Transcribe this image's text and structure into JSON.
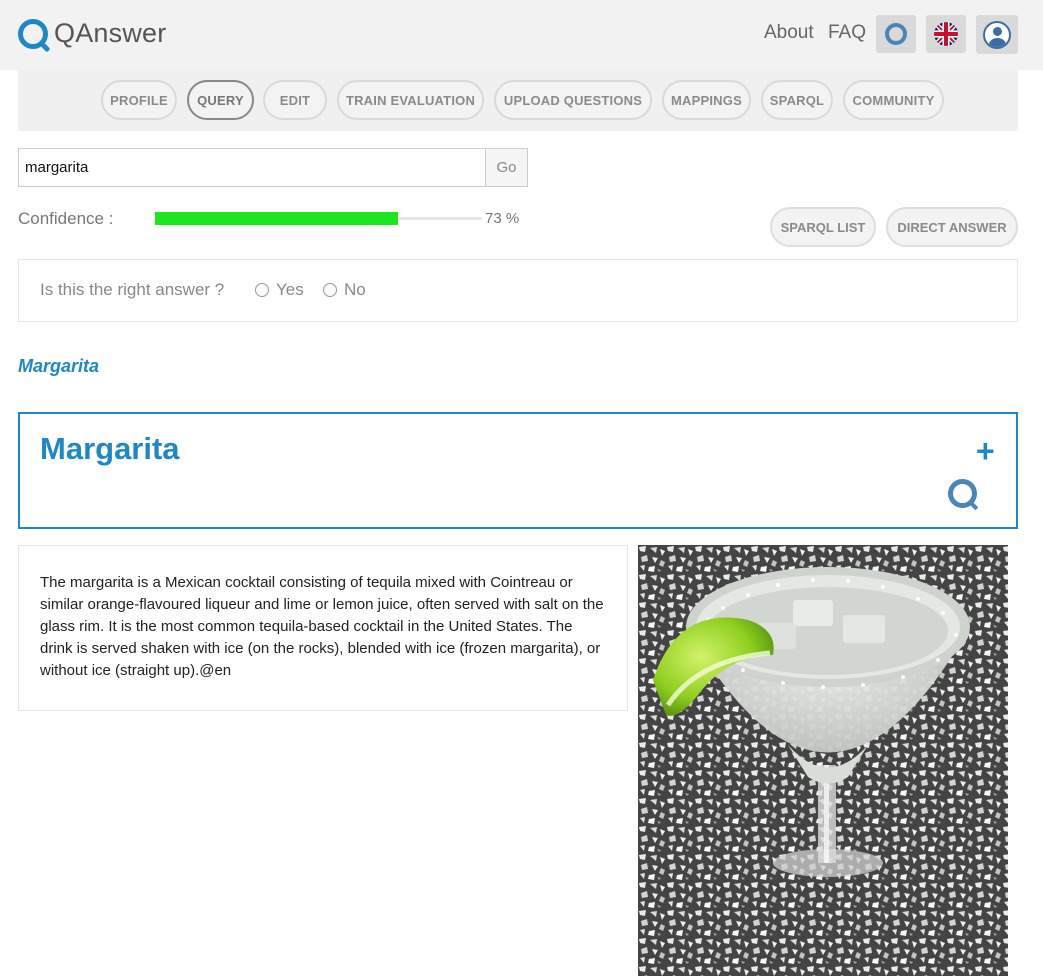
{
  "header": {
    "logo_text": "QAnswer",
    "nav": {
      "about": "About",
      "faq": "FAQ"
    },
    "icons": [
      "qanswer-ring-icon",
      "uk-flag-icon",
      "user-icon"
    ]
  },
  "tabs": [
    {
      "label": "PROFILE",
      "active": false
    },
    {
      "label": "QUERY",
      "active": true
    },
    {
      "label": "EDIT",
      "active": false
    },
    {
      "label": "TRAIN EVALUATION",
      "active": false
    },
    {
      "label": "UPLOAD QUESTIONS",
      "active": false
    },
    {
      "label": "MAPPINGS",
      "active": false
    },
    {
      "label": "SPARQL",
      "active": false
    },
    {
      "label": "COMMUNITY",
      "active": false
    }
  ],
  "search": {
    "value": "margarita",
    "go_label": "Go"
  },
  "confidence": {
    "label": "Confidence :",
    "value": 0.73,
    "text": "73 %",
    "color": "#1ee61e"
  },
  "actions": {
    "sparql_list": "SPARQL LIST",
    "direct_answer": "DIRECT ANSWER"
  },
  "feedback": {
    "question": "Is this the right answer ?",
    "yes": "Yes",
    "no": "No"
  },
  "answer": {
    "link_label": "Margarita",
    "card_title": "Margarita",
    "expand_symbol": "+",
    "description": "The margarita is a Mexican cocktail consisting of tequila mixed with Cointreau or similar orange-flavoured liqueur and lime or lemon juice, often served with salt on the glass rim. It is the most common tequila-based cocktail in the United States. The drink is served shaken with ice (on the rocks), blended with ice (frozen margarita), or without ice (straight up).@en"
  },
  "colors": {
    "accent": "#1e87c8",
    "header_bg": "#f2f2f2"
  }
}
